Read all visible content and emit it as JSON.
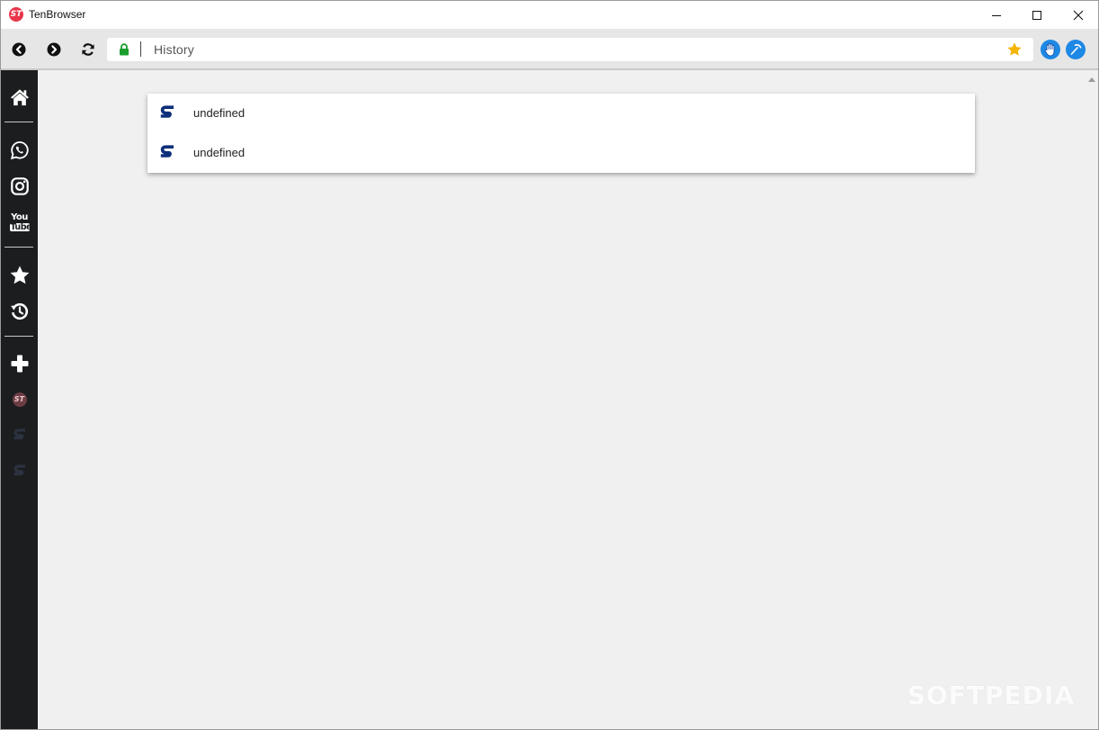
{
  "window": {
    "title": "TenBrowser",
    "logo_text": "ST",
    "controls": [
      "minimize",
      "maximize",
      "close"
    ]
  },
  "toolbar": {
    "back_icon": "back-arrow-icon",
    "forward_icon": "forward-arrow-icon",
    "reload_icon": "reload-icon",
    "address": {
      "value": "History",
      "secure": true,
      "lock_color": "#1b9e2e"
    },
    "bookmark_star_color": "#f5b400",
    "extensions": [
      {
        "icon": "hand-icon",
        "color": "#1e88e5"
      },
      {
        "icon": "pickaxe-icon",
        "color": "#1e88e5"
      }
    ]
  },
  "sidebar": {
    "items": [
      {
        "icon": "home-icon"
      },
      {
        "icon": "whatsapp-icon"
      },
      {
        "icon": "instagram-icon"
      },
      {
        "icon": "youtube-icon",
        "text": [
          "You",
          "Tube"
        ]
      },
      {
        "icon": "star-icon"
      },
      {
        "icon": "history-icon"
      },
      {
        "icon": "plus-icon"
      },
      {
        "icon": "tenbrowser-icon",
        "text": "ST"
      },
      {
        "icon": "s-shortcut-icon"
      },
      {
        "icon": "s-shortcut-icon"
      }
    ]
  },
  "history": {
    "entries": [
      {
        "label": "undefined",
        "icon": "s-logo-icon"
      },
      {
        "label": "undefined",
        "icon": "s-logo-icon"
      }
    ]
  },
  "watermark": "SOFTPEDIA",
  "colors": {
    "sidebar_bg": "#1b1d1f",
    "toolbar_bg": "#e6e6e6",
    "content_bg": "#f0f0f0",
    "s_logo": "#0d2f7a",
    "logo_red": "#e8364a"
  }
}
